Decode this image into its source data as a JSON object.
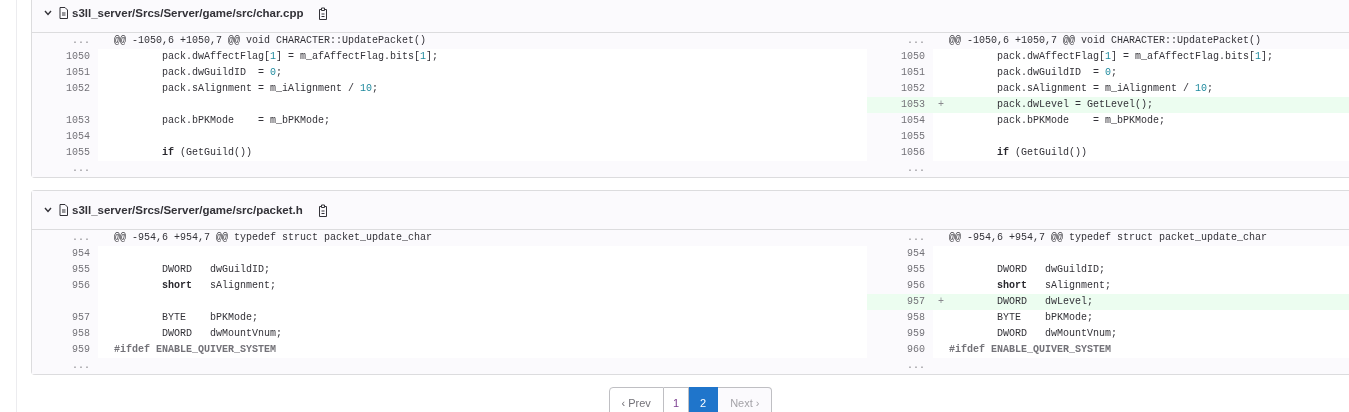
{
  "files": [
    {
      "path": "s3ll_server/Srcs/Server/game/src/char.cpp",
      "expanded": true,
      "sides": [
        {
          "rows": [
            {
              "kind": "hunk",
              "number": "...",
              "code": [
                {
                  "kind": "plain",
                  "text": "@@ -1050,6 +1050,7 @@ void CHARACTER::UpdatePacket()"
                }
              ]
            },
            {
              "kind": "context",
              "number": "1050",
              "code": [
                {
                  "kind": "plain",
                  "text": "        pack.dwAffectFlag["
                },
                {
                  "kind": "number",
                  "text": "1"
                },
                {
                  "kind": "plain",
                  "text": "] = m_afAffectFlag.bits["
                },
                {
                  "kind": "number",
                  "text": "1"
                },
                {
                  "kind": "plain",
                  "text": "];"
                }
              ]
            },
            {
              "kind": "context",
              "number": "1051",
              "code": [
                {
                  "kind": "plain",
                  "text": "        pack.dwGuildID  = "
                },
                {
                  "kind": "number",
                  "text": "0"
                },
                {
                  "kind": "plain",
                  "text": ";"
                }
              ]
            },
            {
              "kind": "context",
              "number": "1052",
              "code": [
                {
                  "kind": "plain",
                  "text": "        pack.sAlignment = m_iAlignment / "
                },
                {
                  "kind": "number",
                  "text": "10"
                },
                {
                  "kind": "plain",
                  "text": ";"
                }
              ]
            },
            {
              "kind": "empty"
            },
            {
              "kind": "context",
              "number": "1053",
              "code": [
                {
                  "kind": "plain",
                  "text": "        pack.bPKMode    = m_bPKMode;"
                }
              ]
            },
            {
              "kind": "context",
              "number": "1054"
            },
            {
              "kind": "context",
              "number": "1055",
              "code": [
                {
                  "kind": "keyword",
                  "text": "        if"
                },
                {
                  "kind": "plain",
                  "text": " (GetGuild())"
                }
              ]
            },
            {
              "kind": "expand",
              "number": "..."
            }
          ]
        },
        {
          "rows": [
            {
              "kind": "hunk",
              "number": "...",
              "code": [
                {
                  "kind": "plain",
                  "text": "@@ -1050,6 +1050,7 @@ void CHARACTER::UpdatePacket()"
                }
              ]
            },
            {
              "kind": "context",
              "number": "1050",
              "code": [
                {
                  "kind": "plain",
                  "text": "        pack.dwAffectFlag["
                },
                {
                  "kind": "number",
                  "text": "1"
                },
                {
                  "kind": "plain",
                  "text": "] = m_afAffectFlag.bits["
                },
                {
                  "kind": "number",
                  "text": "1"
                },
                {
                  "kind": "plain",
                  "text": "];"
                }
              ]
            },
            {
              "kind": "context",
              "number": "1051",
              "code": [
                {
                  "kind": "plain",
                  "text": "        pack.dwGuildID  = "
                },
                {
                  "kind": "number",
                  "text": "0"
                },
                {
                  "kind": "plain",
                  "text": ";"
                }
              ]
            },
            {
              "kind": "context",
              "number": "1052",
              "code": [
                {
                  "kind": "plain",
                  "text": "        pack.sAlignment = m_iAlignment / "
                },
                {
                  "kind": "number",
                  "text": "10"
                },
                {
                  "kind": "plain",
                  "text": ";"
                }
              ]
            },
            {
              "kind": "added",
              "number": "1053",
              "marker": "+",
              "code": [
                {
                  "kind": "plain",
                  "text": "        pack.dwLevel = GetLevel();"
                }
              ]
            },
            {
              "kind": "context",
              "number": "1054",
              "code": [
                {
                  "kind": "plain",
                  "text": "        pack.bPKMode    = m_bPKMode;"
                }
              ]
            },
            {
              "kind": "context",
              "number": "1055"
            },
            {
              "kind": "context",
              "number": "1056",
              "code": [
                {
                  "kind": "keyword",
                  "text": "        if"
                },
                {
                  "kind": "plain",
                  "text": " (GetGuild())"
                }
              ]
            },
            {
              "kind": "expand",
              "number": "..."
            }
          ]
        }
      ]
    },
    {
      "path": "s3ll_server/Srcs/Server/game/src/packet.h",
      "expanded": true,
      "sides": [
        {
          "rows": [
            {
              "kind": "hunk",
              "number": "...",
              "code": [
                {
                  "kind": "plain",
                  "text": "@@ -954,6 +954,7 @@ typedef struct packet_update_char"
                }
              ]
            },
            {
              "kind": "context",
              "number": "954"
            },
            {
              "kind": "context",
              "number": "955",
              "code": [
                {
                  "kind": "plain",
                  "text": "        DWORD   dwGuildID;"
                }
              ]
            },
            {
              "kind": "context",
              "number": "956",
              "code": [
                {
                  "kind": "keyword",
                  "text": "        short"
                },
                {
                  "kind": "plain",
                  "text": "   sAlignment;"
                }
              ]
            },
            {
              "kind": "empty"
            },
            {
              "kind": "context",
              "number": "957",
              "code": [
                {
                  "kind": "plain",
                  "text": "        BYTE    bPKMode;"
                }
              ]
            },
            {
              "kind": "context",
              "number": "958",
              "code": [
                {
                  "kind": "plain",
                  "text": "        DWORD   dwMountVnum;"
                }
              ]
            },
            {
              "kind": "context",
              "number": "959",
              "code": [
                {
                  "kind": "preproc",
                  "text": "#ifdef ENABLE_QUIVER_SYSTEM"
                }
              ]
            },
            {
              "kind": "expand",
              "number": "..."
            }
          ]
        },
        {
          "rows": [
            {
              "kind": "hunk",
              "number": "...",
              "code": [
                {
                  "kind": "plain",
                  "text": "@@ -954,6 +954,7 @@ typedef struct packet_update_char"
                }
              ]
            },
            {
              "kind": "context",
              "number": "954"
            },
            {
              "kind": "context",
              "number": "955",
              "code": [
                {
                  "kind": "plain",
                  "text": "        DWORD   dwGuildID;"
                }
              ]
            },
            {
              "kind": "context",
              "number": "956",
              "code": [
                {
                  "kind": "keyword",
                  "text": "        short"
                },
                {
                  "kind": "plain",
                  "text": "   sAlignment;"
                }
              ]
            },
            {
              "kind": "added",
              "number": "957",
              "marker": "+",
              "code": [
                {
                  "kind": "plain",
                  "text": "        DWORD   dwLevel;"
                }
              ]
            },
            {
              "kind": "context",
              "number": "958",
              "code": [
                {
                  "kind": "plain",
                  "text": "        BYTE    bPKMode;"
                }
              ]
            },
            {
              "kind": "context",
              "number": "959",
              "code": [
                {
                  "kind": "plain",
                  "text": "        DWORD   dwMountVnum;"
                }
              ]
            },
            {
              "kind": "context",
              "number": "960",
              "code": [
                {
                  "kind": "preproc",
                  "text": "#ifdef ENABLE_QUIVER_SYSTEM"
                }
              ]
            },
            {
              "kind": "expand",
              "number": "..."
            }
          ]
        }
      ]
    }
  ],
  "pagination": {
    "prev": {
      "label": "‹ Prev",
      "disabled": false
    },
    "pages": [
      {
        "label": "1",
        "selected": false,
        "visited": true
      },
      {
        "label": "2",
        "selected": true,
        "visited": false
      }
    ],
    "next": {
      "label": "Next ›",
      "disabled": true
    }
  }
}
